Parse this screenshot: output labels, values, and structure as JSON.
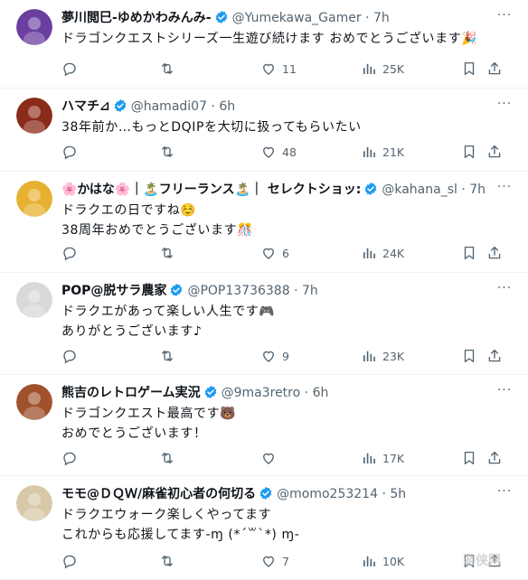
{
  "tweets": [
    {
      "name": "夢川閲巳-ゆめかわみんみ-",
      "handle": "@Yumekawa_Gamer",
      "time": "7h",
      "lines": [
        "ドラゴンクエストシリーズ一生遊び続けます おめでとうございます🎉"
      ],
      "replies": "",
      "reposts": "",
      "likes": "11",
      "views": "25K",
      "avatar_color": "#6b3fa0"
    },
    {
      "name": "ハマチ⊿",
      "handle": "@hamadi07",
      "time": "6h",
      "lines": [
        "38年前か…もっとDQIPを大切に扱ってもらいたい"
      ],
      "replies": "",
      "reposts": "",
      "likes": "48",
      "views": "21K",
      "avatar_color": "#8b2b1a"
    },
    {
      "name": "🌸かはな🌸｜🏝️フリーランス🏝️｜ セレクトショッ:",
      "handle": "@kahana_sl",
      "time": "7h",
      "lines": [
        "ドラクエの日ですね☺️",
        "38周年おめでとうございます🎊"
      ],
      "replies": "",
      "reposts": "",
      "likes": "6",
      "views": "24K",
      "avatar_color": "#e6b030"
    },
    {
      "name": "POP@脱サラ農家",
      "handle": "@POP13736388",
      "time": "7h",
      "lines": [
        "ドラクエがあって楽しい人生です🎮",
        "ありがとうございます♪"
      ],
      "replies": "",
      "reposts": "",
      "likes": "9",
      "views": "23K",
      "avatar_color": "#d9d9d9"
    },
    {
      "name": "熊吉のレトロゲーム実況",
      "handle": "@9ma3retro",
      "time": "6h",
      "lines": [
        "ドラゴンクエスト最高です🐻",
        "おめでとうございます！"
      ],
      "replies": "",
      "reposts": "",
      "likes": "",
      "views": "17K",
      "avatar_color": "#a0522d"
    },
    {
      "name": "モモ@ＤＱＷ/麻雀初心者の何切る",
      "handle": "@momo253214",
      "time": "5h",
      "lines": [
        "ドラクエウォーク楽しくやってます",
        "これからも応援してます-ɱ (*´꒳`*) ɱ-"
      ],
      "replies": "",
      "reposts": "",
      "likes": "7",
      "views": "10K",
      "avatar_color": "#d8c8a8"
    }
  ],
  "watermark": "游侠网"
}
